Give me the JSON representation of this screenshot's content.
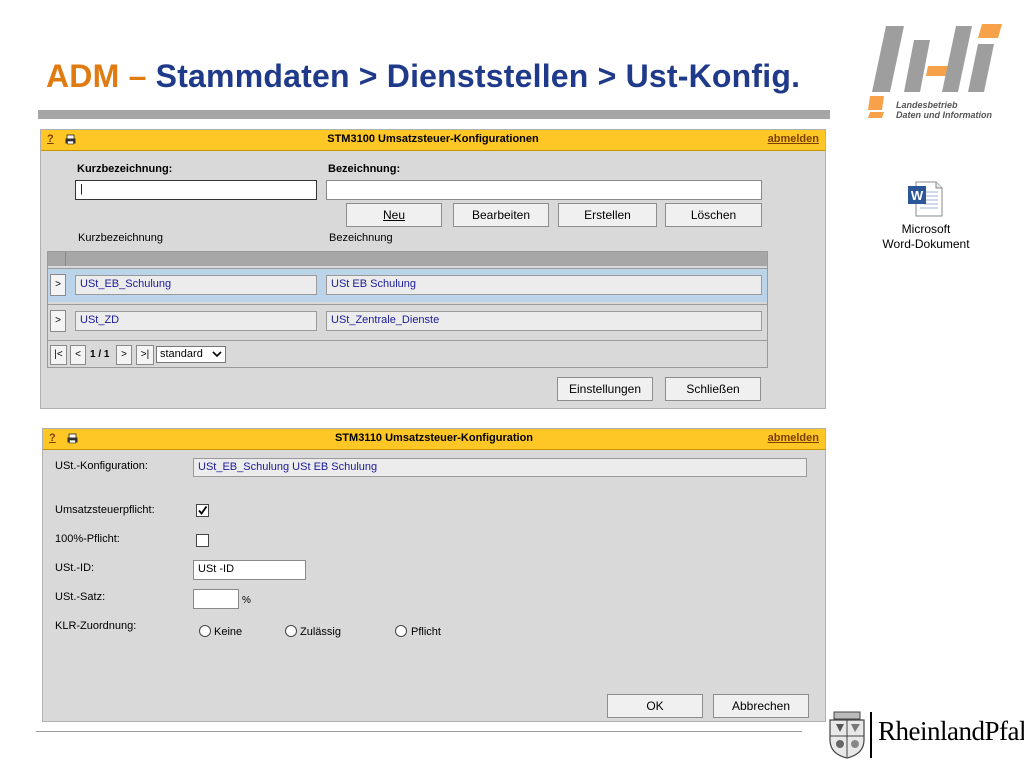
{
  "slide": {
    "title_prefix": "ADM –",
    "title_rest": " Stammdaten > Dienststellen > Ust-Konfig."
  },
  "logo_ldi": {
    "line1": "Landesbetrieb",
    "line2": "Daten und Information",
    "icon": "ldi-logo"
  },
  "word_attachment": {
    "line1": "Microsoft",
    "line2": "Word-Dokument",
    "icon": "word-document-icon"
  },
  "rlp_logo": {
    "text": "RheinlandPfalz",
    "icon": "rlp-coat-of-arms"
  },
  "colors": {
    "header": "#ffc726",
    "title_blue": "#1f3a8a",
    "title_orange": "#e07b12",
    "panel": "#d9d9d9",
    "selected_row": "#bcd4ea"
  },
  "dialog1": {
    "help": "?",
    "title": "STM3100 Umsatzsteuer-Konfigurationen",
    "logout": "abmelden",
    "kurz_label": "Kurzbezeichnung:",
    "bez_label": "Bezeichnung:",
    "kurz_value": "|",
    "bez_value": "",
    "buttons": {
      "neu": "Neu",
      "bearbeiten": "Bearbeiten",
      "erstellen": "Erstellen",
      "loeschen": "Löschen"
    },
    "col_kurz": "Kurzbezeichnung",
    "col_bez": "Bezeichnung",
    "rows": [
      {
        "select": ">",
        "kurz": "USt_EB_Schulung",
        "bez": "USt EB Schulung"
      },
      {
        "select": ">",
        "kurz": "USt_ZD",
        "bez": "USt_Zentrale_Dienste"
      }
    ],
    "pager": {
      "first": "|<",
      "prev": "<",
      "page": "1 / 1",
      "next": ">",
      "last": ">|",
      "view": "standard"
    },
    "footer": {
      "einstellungen": "Einstellungen",
      "schliessen": "Schließen"
    }
  },
  "dialog2": {
    "help": "?",
    "title": "STM3110 Umsatzsteuer-Konfiguration",
    "logout": "abmelden",
    "konfig_label": "USt.-Konfiguration:",
    "konfig_value": "USt_EB_Schulung USt EB Schulung",
    "pflicht_label": "Umsatzsteuerpflicht:",
    "pflicht_checked": true,
    "pflicht100_label": "100%-Pflicht:",
    "pflicht100_checked": false,
    "id_label": "USt.-ID:",
    "id_value": "USt -ID",
    "satz_label": "USt.-Satz:",
    "satz_value": "",
    "satz_unit": "%",
    "klr_label": "KLR-Zuordnung:",
    "klr_options": [
      "Keine",
      "Zulässig",
      "Pflicht"
    ],
    "ok": "OK",
    "abbrechen": "Abbrechen"
  }
}
